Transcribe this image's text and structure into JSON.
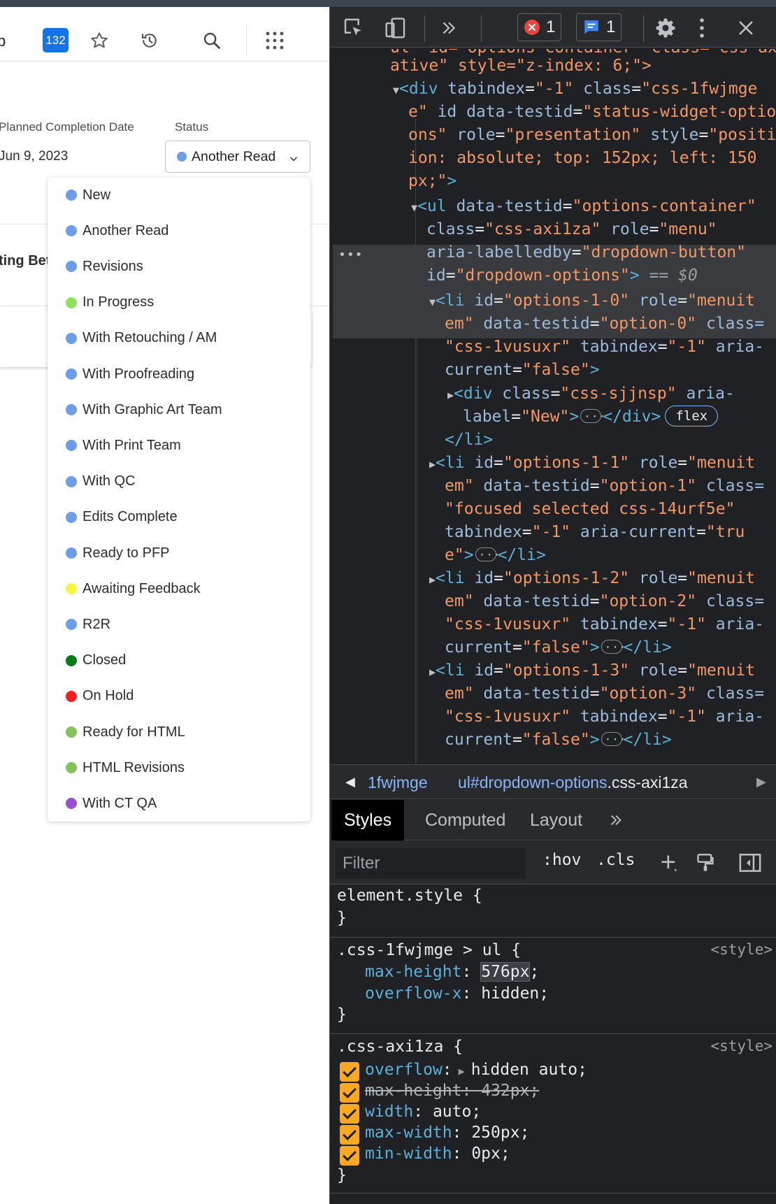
{
  "app": {
    "header": {
      "partial_label": "p",
      "notification_count": "132"
    },
    "fields": {
      "planned_completion_label": "Planned Completion Date",
      "planned_completion_value": "Jun 9, 2023",
      "status_label": "Status",
      "status_value": "Another Read",
      "status_color": "#6e9de8"
    },
    "partial_heading": "ting Bet",
    "status_options": [
      {
        "label": "New",
        "color": "#6e9de8"
      },
      {
        "label": "Another Read",
        "color": "#6e9de8"
      },
      {
        "label": "Revisions",
        "color": "#6e9de8"
      },
      {
        "label": "In Progress",
        "color": "#8fe25a"
      },
      {
        "label": "With Retouching / AM",
        "color": "#6e9de8"
      },
      {
        "label": "With Proofreading",
        "color": "#6e9de8"
      },
      {
        "label": "With Graphic Art Team",
        "color": "#6e9de8"
      },
      {
        "label": "With Print Team",
        "color": "#6e9de8"
      },
      {
        "label": "With QC",
        "color": "#6e9de8"
      },
      {
        "label": "Edits Complete",
        "color": "#6e9de8"
      },
      {
        "label": "Ready to PFP",
        "color": "#6e9de8"
      },
      {
        "label": "Awaiting Feedback",
        "color": "#f4f442"
      },
      {
        "label": "R2R",
        "color": "#6e9de8"
      },
      {
        "label": "Closed",
        "color": "#0a7a14"
      },
      {
        "label": "On Hold",
        "color": "#ee2020"
      },
      {
        "label": "Ready for HTML",
        "color": "#84c25a"
      },
      {
        "label": "HTML Revisions",
        "color": "#84c25a"
      },
      {
        "label": "With CT QA",
        "color": "#9b4fd1"
      }
    ]
  },
  "devtools": {
    "toolbar": {
      "error_count": "1",
      "message_count": "1"
    },
    "dom": {
      "line0": "ative\" style=\"z-index: 6;\">",
      "div_class": "css-1fwjmge",
      "div_testid": "status-widget-options",
      "div_style": "position: absolute; top: 152px; left: 150px;",
      "ul_testid": "options-container",
      "ul_class": "css-axi1za",
      "ul_role": "menu",
      "ul_labelledby": "dropdown-button",
      "ul_id": "dropdown-options",
      "eq_marker": "== $0",
      "li0_id": "options-1-0",
      "li0_testid": "option-0",
      "li0_class": "css-1vusuxr",
      "li0_div_class": "css-sjjnsp",
      "li0_div_label": "New",
      "flex_badge": "flex",
      "li1_id": "options-1-1",
      "li1_testid": "option-1",
      "li1_class": "focused selected css-14urf5e",
      "li2_id": "options-1-2",
      "li2_testid": "option-2",
      "li2_class": "css-1vusuxr",
      "li3_id": "options-1-3",
      "li3_testid": "option-3",
      "li3_class": "css-1vusuxr"
    },
    "breadcrumbs": {
      "first": "1fwjmge",
      "second_tag": "ul#dropdown-options",
      "second_class": ".css-axi1za"
    },
    "tabs": [
      "Styles",
      "Computed",
      "Layout"
    ],
    "filter": {
      "placeholder": "Filter",
      "hov": ":hov",
      "cls": ".cls"
    },
    "styles": {
      "element_style": "element.style {",
      "rule1_selector": ".css-1fwjmge > ul {",
      "rule1_source": "<style>",
      "rule1_max_height_prop": "max-height",
      "rule1_max_height_val": "576px",
      "rule1_overflow_prop": "overflow-x",
      "rule1_overflow_val": "hidden",
      "rule2_selector": ".css-axi1za {",
      "rule2_source": "<style>",
      "rule2_overflow_prop": "overflow",
      "rule2_overflow_val": "hidden auto",
      "rule2_maxh_text": "max-height: 432px;",
      "rule2_width_prop": "width",
      "rule2_width_val": "auto",
      "rule2_maxw_prop": "max-width",
      "rule2_maxw_val": "250px",
      "rule2_minw_prop": "min-width",
      "rule2_minw_val": "0px"
    }
  }
}
